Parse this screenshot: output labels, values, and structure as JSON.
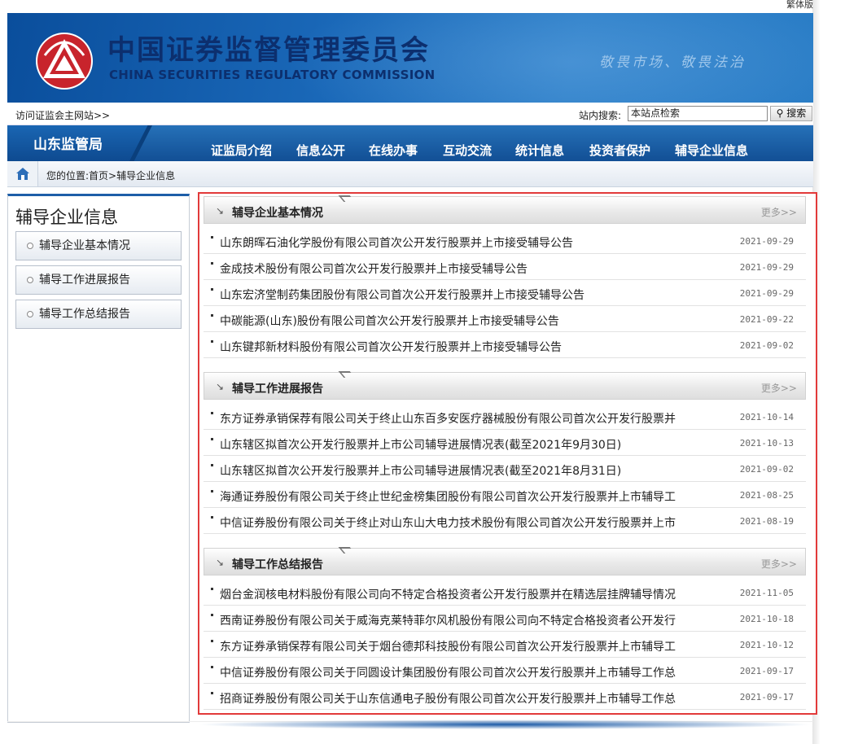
{
  "topbar": {
    "traditional_link": "繁体版"
  },
  "banner": {
    "logo_icon": "csrc-logo-icon",
    "cn_title": "中国证券监督管理委员会",
    "en_title": "CHINA SECURITIES REGULATORY COMMISSION",
    "slogan": "敬畏市场、敬畏法治"
  },
  "strip": {
    "visit_link": "访问证监会主网站>>",
    "search_label": "站内搜索:",
    "search_value": "本站点检索",
    "search_button": "搜索",
    "search_icon": "magnifier-icon"
  },
  "nav": {
    "region": "山东监管局",
    "items": [
      "证监局介绍",
      "信息公开",
      "在线办事",
      "互动交流",
      "统计信息",
      "投资者保护",
      "辅导企业信息"
    ]
  },
  "breadcrumb": {
    "home_icon": "home-icon",
    "text": "您的位置:首页>辅导企业信息"
  },
  "sidebar": {
    "title": "辅导企业信息",
    "items": [
      "辅导企业基本情况",
      "辅导工作进展报告",
      "辅导工作总结报告"
    ]
  },
  "sections": [
    {
      "title": "辅导企业基本情况",
      "more": "更多>>",
      "rows": [
        {
          "text": "山东朗晖石油化学股份有限公司首次公开发行股票并上市接受辅导公告",
          "date": "2021-09-29"
        },
        {
          "text": "金成技术股份有限公司首次公开发行股票并上市接受辅导公告",
          "date": "2021-09-29"
        },
        {
          "text": "山东宏济堂制药集团股份有限公司首次公开发行股票并上市接受辅导公告",
          "date": "2021-09-29"
        },
        {
          "text": "中碳能源(山东)股份有限公司首次公开发行股票并上市接受辅导公告",
          "date": "2021-09-22"
        },
        {
          "text": "山东键邦新材料股份有限公司首次公开发行股票并上市接受辅导公告",
          "date": "2021-09-02"
        }
      ]
    },
    {
      "title": "辅导工作进展报告",
      "more": "更多>>",
      "rows": [
        {
          "text": "东方证券承销保荐有限公司关于终止山东百多安医疗器械股份有限公司首次公开发行股票并",
          "date": "2021-10-14"
        },
        {
          "text": "山东辖区拟首次公开发行股票并上市公司辅导进展情况表(截至2021年9月30日)",
          "date": "2021-10-13"
        },
        {
          "text": "山东辖区拟首次公开发行股票并上市公司辅导进展情况表(截至2021年8月31日)",
          "date": "2021-09-02"
        },
        {
          "text": "海通证券股份有限公司关于终止世纪金榜集团股份有限公司首次公开发行股票并上市辅导工",
          "date": "2021-08-25"
        },
        {
          "text": "中信证券股份有限公司关于终止对山东山大电力技术股份有限公司首次公开发行股票并上市",
          "date": "2021-08-19"
        }
      ]
    },
    {
      "title": "辅导工作总结报告",
      "more": "更多>>",
      "rows": [
        {
          "text": "烟台金润核电材料股份有限公司向不特定合格投资者公开发行股票并在精选层挂牌辅导情况",
          "date": "2021-11-05"
        },
        {
          "text": "西南证券股份有限公司关于威海克莱特菲尔风机股份有限公司向不特定合格投资者公开发行",
          "date": "2021-10-18"
        },
        {
          "text": "东方证券承销保荐有限公司关于烟台德邦科技股份有限公司首次公开发行股票并上市辅导工",
          "date": "2021-10-12"
        },
        {
          "text": "中信证券股份有限公司关于同圆设计集团股份有限公司首次公开发行股票并上市辅导工作总",
          "date": "2021-09-17"
        },
        {
          "text": "招商证券股份有限公司关于山东信通电子股份有限公司首次公开发行股票并上市辅导工作总",
          "date": "2021-09-17"
        }
      ]
    }
  ],
  "colors": {
    "brand_blue": "#1a68b8",
    "nav_blue": "#124f95",
    "highlight_red": "#e23a3a",
    "logo_red": "#c8242c"
  }
}
